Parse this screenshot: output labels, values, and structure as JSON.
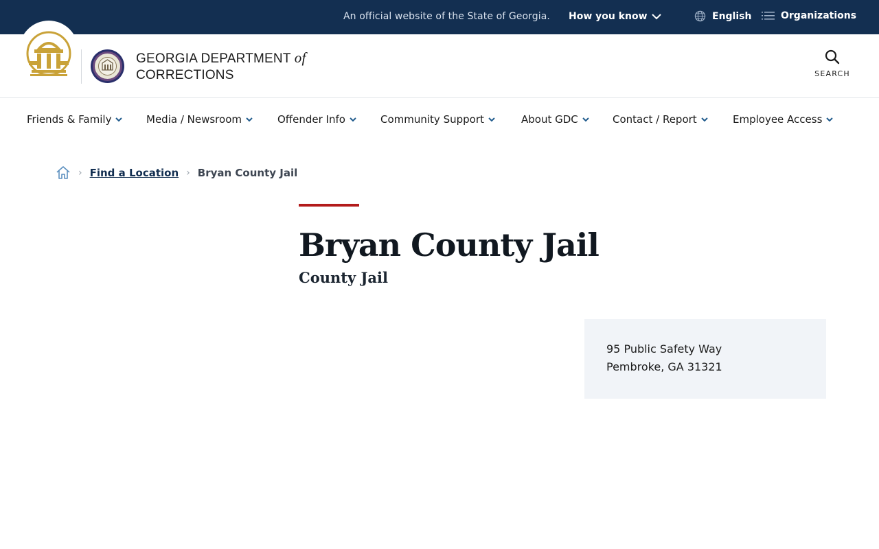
{
  "banner": {
    "official_text": "An official website of the State of Georgia.",
    "how_you_know": "How you know",
    "language": "English",
    "organizations": "Organizations"
  },
  "header": {
    "agency_line1_prefix": "GEORGIA DEPARTMENT",
    "agency_line1_italic": "of",
    "agency_line2": "CORRECTIONS",
    "search_label": "SEARCH"
  },
  "nav": {
    "items": [
      {
        "label": "Friends & Family"
      },
      {
        "label": "Media / Newsroom"
      },
      {
        "label": "Offender Info"
      },
      {
        "label": "Community Support"
      },
      {
        "label": "About GDC"
      },
      {
        "label": "Contact / Report"
      },
      {
        "label": "Employee Access"
      }
    ]
  },
  "breadcrumb": {
    "home_icon": "home-icon",
    "link": "Find a Location",
    "current": "Bryan County Jail"
  },
  "page": {
    "title": "Bryan County Jail",
    "subtitle": "County Jail"
  },
  "address": {
    "line1": "95 Public Safety Way",
    "line2": "Pembroke, GA 31321"
  },
  "colors": {
    "banner_bg": "#132f51",
    "accent_red": "#b31b1b",
    "card_bg": "#f1f4f8",
    "chevron_blue": "#1f5a8c",
    "seal_gold": "#c9a238"
  }
}
